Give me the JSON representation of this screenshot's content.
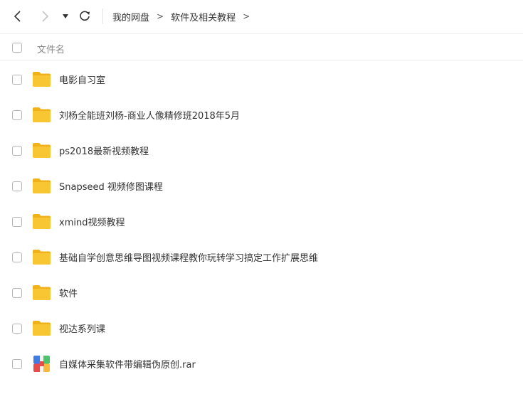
{
  "toolbar": {
    "back_icon": "chevron-left-icon",
    "forward_icon": "chevron-right-icon",
    "history_icon": "caret-down-icon",
    "refresh_icon": "refresh-icon"
  },
  "breadcrumb": {
    "items": [
      "我的网盘",
      "软件及相关教程"
    ],
    "separator": ">"
  },
  "list": {
    "header_label": "文件名",
    "items": [
      {
        "name": "电影自习室",
        "type": "folder"
      },
      {
        "name": "刘杨全能班刘杨-商业人像精修班2018年5月",
        "type": "folder"
      },
      {
        "name": "ps2018最新视频教程",
        "type": "folder"
      },
      {
        "name": "Snapseed 视频修图课程",
        "type": "folder"
      },
      {
        "name": "xmind视频教程",
        "type": "folder"
      },
      {
        "name": "基础自学创意思维导图视频课程教你玩转学习搞定工作扩展思维",
        "type": "folder"
      },
      {
        "name": "软件",
        "type": "folder"
      },
      {
        "name": "视达系列课",
        "type": "folder"
      },
      {
        "name": "自媒体采集软件带编辑伪原创.rar",
        "type": "archive"
      }
    ]
  },
  "colors": {
    "folder": "#F9C633",
    "folder_tab": "#F0B21C",
    "archive_blue": "#3C7DE6",
    "archive_red": "#E84B4B",
    "archive_green": "#4CC36B",
    "archive_yellow": "#F6B93B"
  }
}
